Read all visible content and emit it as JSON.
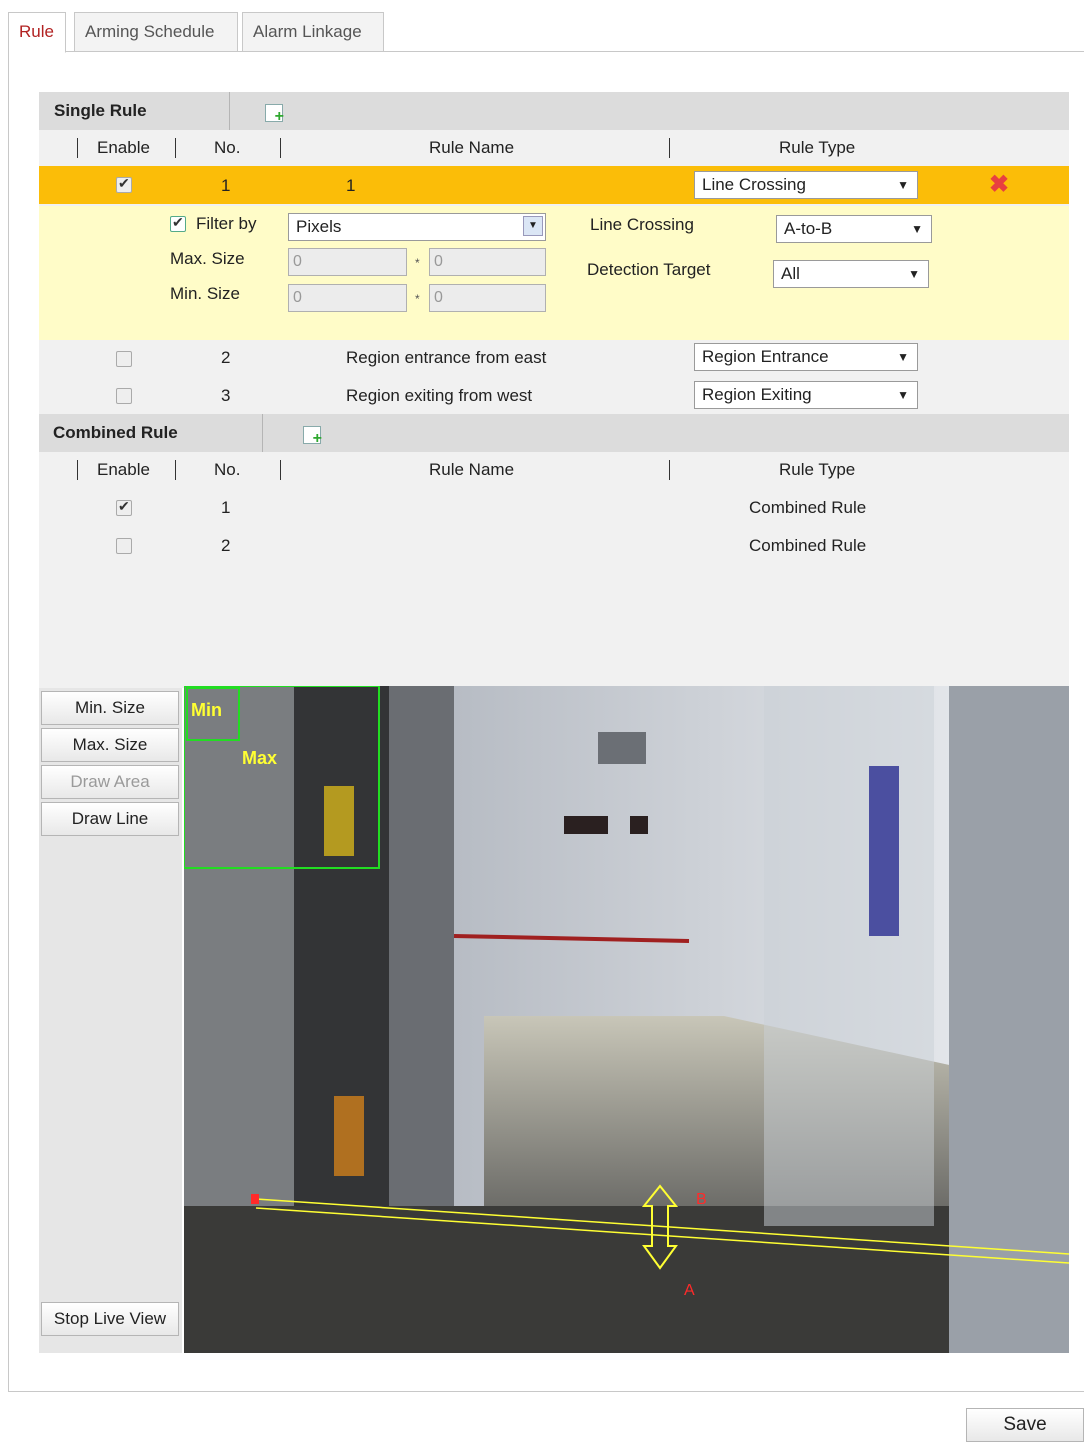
{
  "tabs": [
    {
      "label": "Rule",
      "active": true
    },
    {
      "label": "Arming Schedule",
      "active": false
    },
    {
      "label": "Alarm Linkage",
      "active": false
    }
  ],
  "single_rule": {
    "title": "Single Rule",
    "columns": {
      "enable": "Enable",
      "no": "No.",
      "name": "Rule Name",
      "type": "Rule Type"
    },
    "rows": [
      {
        "enabled": true,
        "no": "1",
        "name": "1",
        "type": "Line Crossing",
        "selected": true
      },
      {
        "enabled": false,
        "no": "2",
        "name": "Region entrance from east",
        "type": "Region Entrance",
        "selected": false
      },
      {
        "enabled": false,
        "no": "3",
        "name": "Region exiting from west",
        "type": "Region Exiting",
        "selected": false
      }
    ],
    "detail": {
      "filter_label": "Filter by",
      "filter_checked": true,
      "filter_value": "Pixels",
      "max_label": "Max. Size",
      "min_label": "Min. Size",
      "max_w": "0",
      "max_h": "0",
      "min_w": "0",
      "min_h": "0",
      "line_crossing_label": "Line Crossing",
      "line_crossing_value": "A-to-B",
      "target_label": "Detection Target",
      "target_value": "All"
    }
  },
  "combined_rule": {
    "title": "Combined Rule",
    "columns": {
      "enable": "Enable",
      "no": "No.",
      "name": "Rule Name",
      "type": "Rule Type"
    },
    "rows": [
      {
        "enabled": true,
        "no": "1",
        "type": "Combined Rule"
      },
      {
        "enabled": false,
        "no": "2",
        "type": "Combined Rule"
      }
    ]
  },
  "toolbar": {
    "min_size": "Min. Size",
    "max_size": "Max. Size",
    "draw_area": "Draw Area",
    "draw_line": "Draw Line",
    "stop_live_view": "Stop Live View"
  },
  "video_overlay": {
    "min_label": "Min",
    "max_label": "Max",
    "point_a": "A",
    "point_b": "B"
  },
  "save_label": "Save",
  "colors": {
    "selected_row": "#fbbd08",
    "detail_bg": "#fffcc8",
    "overlay_green": "#22dd22",
    "overlay_yellow": "#ffff33",
    "marker_red": "#ff2a2a"
  }
}
